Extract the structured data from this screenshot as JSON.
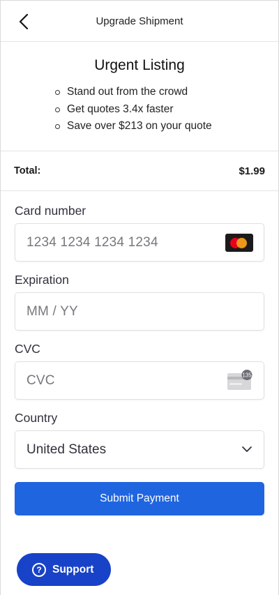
{
  "header": {
    "title": "Upgrade Shipment",
    "back_icon": "chevron-left-icon"
  },
  "listing": {
    "title": "Urgent Listing",
    "benefits": [
      "Stand out from the crowd",
      "Get quotes 3.4x faster",
      "Save over $213 on your quote"
    ]
  },
  "total": {
    "label": "Total:",
    "value": "$1.99"
  },
  "form": {
    "card_number": {
      "label": "Card number",
      "placeholder": "1234 1234 1234 1234",
      "icon": "mastercard-icon"
    },
    "expiration": {
      "label": "Expiration",
      "placeholder": "MM / YY"
    },
    "cvc": {
      "label": "CVC",
      "placeholder": "CVC",
      "icon": "cvc-card-icon",
      "icon_text": "135"
    },
    "country": {
      "label": "Country",
      "value": "United States",
      "icon": "chevron-down-icon"
    },
    "submit_label": "Submit Payment"
  },
  "support": {
    "label": "Support",
    "icon": "help-circle-icon",
    "icon_glyph": "?"
  },
  "colors": {
    "primary_button": "#1f65e0",
    "support_button": "#1842c7",
    "mastercard_red": "#eb001b",
    "mastercard_yellow": "#f79e1b"
  }
}
